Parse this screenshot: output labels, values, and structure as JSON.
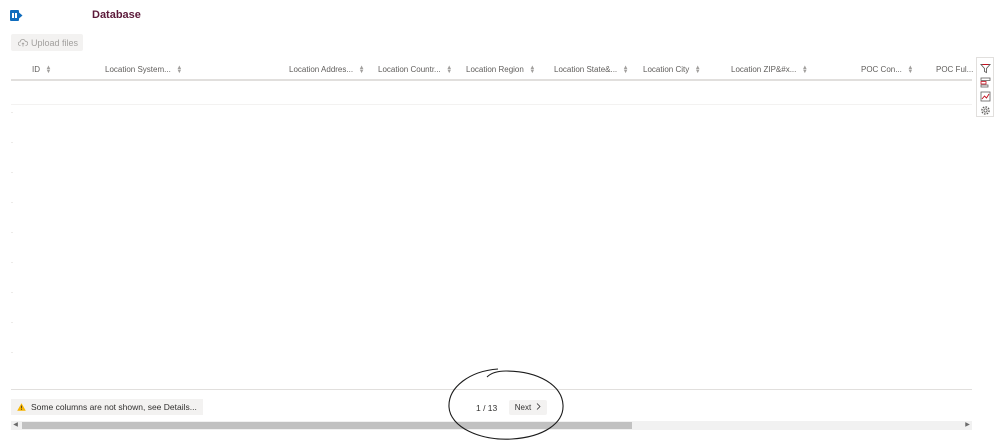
{
  "header": {
    "title": "Database"
  },
  "toolbar": {
    "upload_label": "Upload files"
  },
  "grid": {
    "columns": [
      "ID",
      "Location System...",
      "Location Addres...",
      "Location Countr...",
      "Location Region",
      "Location State&...",
      "Location City",
      "Location ZIP&#x...",
      "POC Con...",
      "POC Ful..."
    ]
  },
  "footer": {
    "notice": "Some columns are not shown, see Details...",
    "page_indicator": "1 / 13",
    "next_label": "Next"
  },
  "icons": {
    "app": "sharepoint-list-icon",
    "upload": "cloud-upload-icon",
    "warning": "warning-icon",
    "side_tools": [
      "filter-icon",
      "group-icon",
      "chart-icon",
      "settings-icon"
    ]
  },
  "colors": {
    "title": "#5c1a3a",
    "brand": "#0f6cbd",
    "warning": "#f7b500"
  }
}
